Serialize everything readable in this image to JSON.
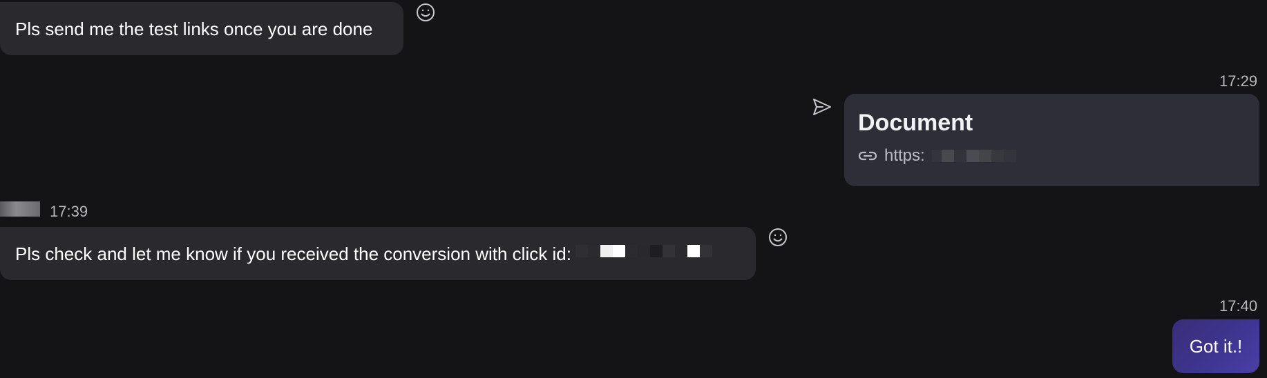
{
  "messages": [
    {
      "id": "msg1",
      "direction": "incoming",
      "text": "Pls send me the test links once you are done"
    },
    {
      "id": "doc",
      "direction": "outgoing",
      "time": "17:29",
      "card_title": "Document",
      "link_prefix": "https:"
    },
    {
      "id": "msg2",
      "direction": "incoming",
      "time": "17:39",
      "text": "Pls check and let me know if you received the conversion with click id:"
    },
    {
      "id": "msg3",
      "direction": "outgoing",
      "time": "17:40",
      "text": "Got it.!"
    }
  ],
  "icons": {
    "reaction": "smiley-icon",
    "sent_status": "send-icon",
    "link": "link-icon"
  },
  "colors": {
    "background": "#141416",
    "incoming_bubble": "#2a2a2e",
    "document_card": "#2e2e38",
    "outgoing_bubble_start": "#3a2e78",
    "outgoing_bubble_end": "#4a3fa8",
    "timestamp": "#b8b8bc"
  }
}
